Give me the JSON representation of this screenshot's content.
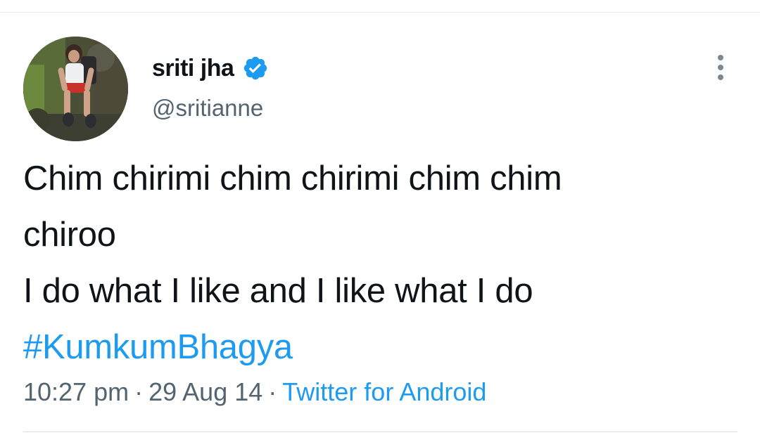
{
  "tweet": {
    "author": {
      "display_name": "sriti jha",
      "handle": "@sritianne",
      "verified": true,
      "avatar_icon": "profile-photo-person-sitting-outdoors"
    },
    "text": {
      "line1": "Chim chirimi chim chirimi chim chim",
      "line2": "chiroo",
      "line3": "I do what I like and I like what I do",
      "hashtag": "#KumkumBhagya"
    },
    "meta": {
      "time": "10:27 pm",
      "separator": "·",
      "date": "29 Aug 14",
      "source": "Twitter for Android"
    },
    "more_icon": "more-vertical-icon"
  },
  "colors": {
    "text_primary": "#0f1419",
    "text_secondary": "#536471",
    "accent": "#1d9bf0",
    "divider": "#e6ecf0"
  }
}
